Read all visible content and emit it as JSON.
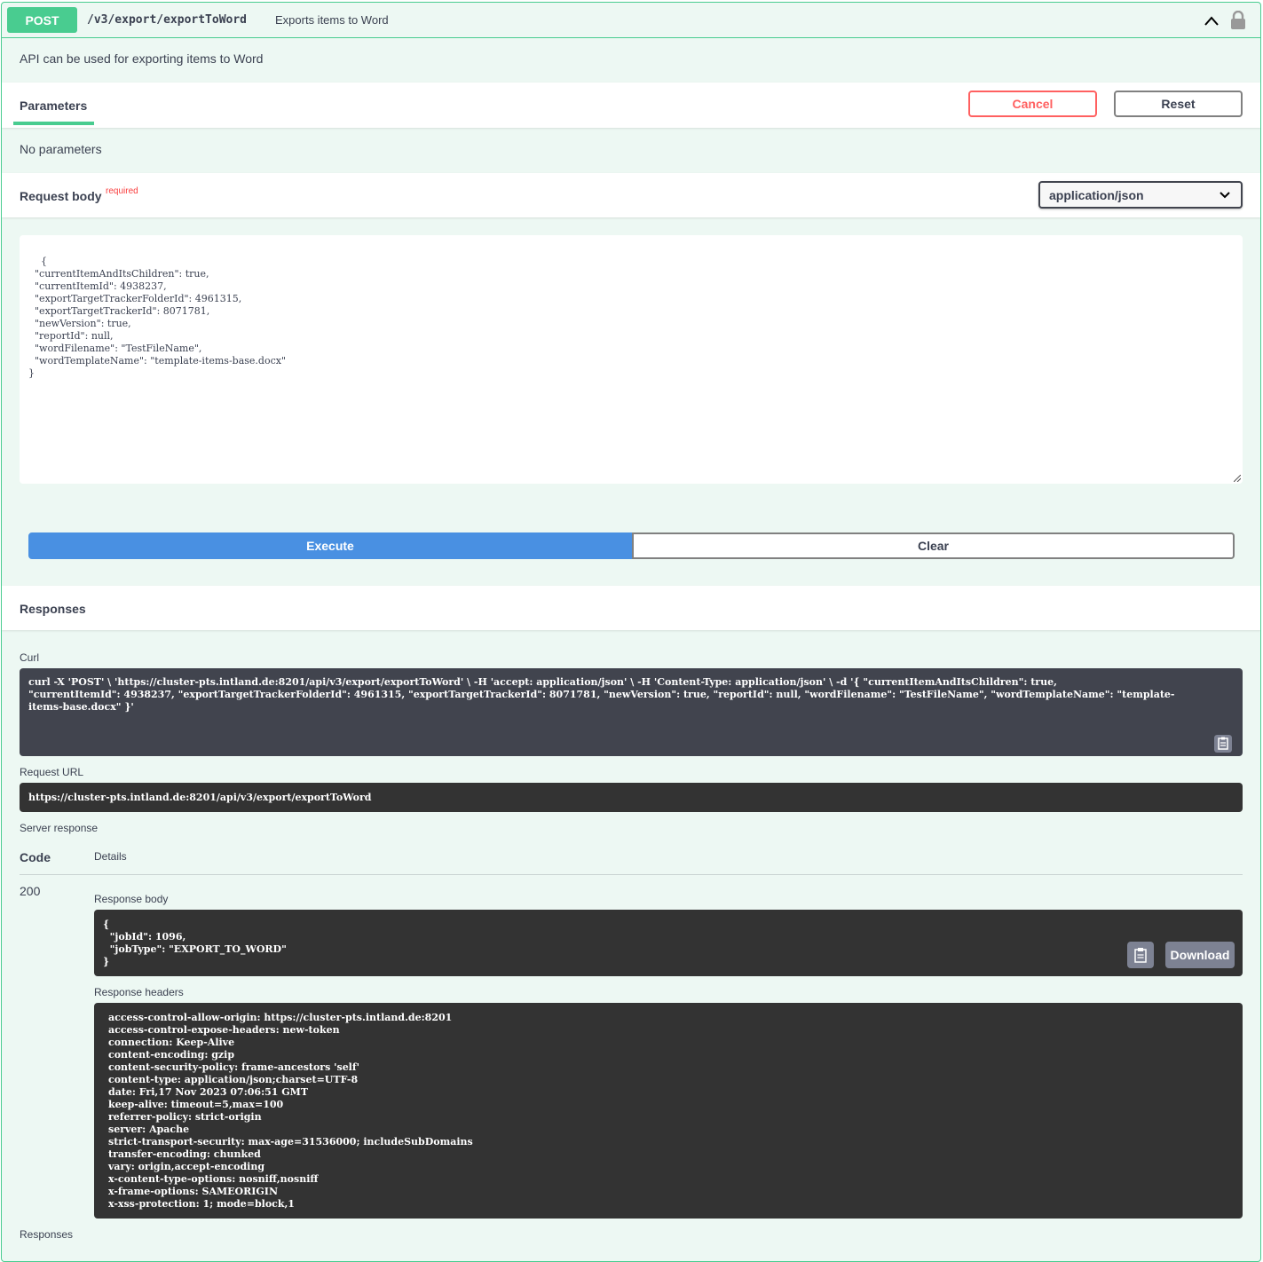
{
  "summary": {
    "method": "POST",
    "path": "/v3/export/exportToWord",
    "title": "Exports items to Word",
    "icons": [
      "chevron-up-icon",
      "lock-icon"
    ]
  },
  "description": "API can be used for exporting items to Word",
  "parameters": {
    "tab_label": "Parameters",
    "cancel_label": "Cancel",
    "reset_label": "Reset",
    "empty_text": "No parameters"
  },
  "request_body": {
    "label": "Request body",
    "required_flag": "required",
    "content_type": "application/json",
    "value": "{\n  \"currentItemAndItsChildren\": true,\n  \"currentItemId\": 4938237,\n  \"exportTargetTrackerFolderId\": 4961315,\n  \"exportTargetTrackerId\": 8071781,\n  \"newVersion\": true,\n  \"reportId\": null,\n  \"wordFilename\": \"TestFileName\",\n  \"wordTemplateName\": \"template-items-base.docx\"\n}"
  },
  "actions": {
    "execute_label": "Execute",
    "clear_label": "Clear"
  },
  "responses": {
    "heading": "Responses",
    "curl_label": "Curl",
    "curl_value": "curl -X 'POST' \\ 'https://cluster-pts.intland.de:8201/api/v3/export/exportToWord' \\ -H 'accept: application/json' \\ -H 'Content-Type: application/json' \\ -d '{ \"currentItemAndItsChildren\": true,\n\"currentItemId\": 4938237, \"exportTargetTrackerFolderId\": 4961315, \"exportTargetTrackerId\": 8071781, \"newVersion\": true, \"reportId\": null, \"wordFilename\": \"TestFileName\", \"wordTemplateName\": \"template-\nitems-base.docx\" }'",
    "request_url_label": "Request URL",
    "request_url": "https://cluster-pts.intland.de:8201/api/v3/export/exportToWord",
    "server_response_label": "Server response",
    "col_code": "Code",
    "col_details": "Details",
    "status_code": "200",
    "response_body_label": "Response body",
    "response_body": "{\n  \"jobId\": 1096,\n  \"jobType\": \"EXPORT_TO_WORD\"\n}",
    "download_label": "Download",
    "response_headers_label": "Response headers",
    "response_headers": "access-control-allow-origin: https://cluster-pts.intland.de:8201\naccess-control-expose-headers: new-token\nconnection: Keep-Alive\ncontent-encoding: gzip\ncontent-security-policy: frame-ancestors 'self'\ncontent-type: application/json;charset=UTF-8\ndate: Fri,17 Nov 2023 07:06:51 GMT\nkeep-alive: timeout=5,max=100\nreferrer-policy: strict-origin\nserver: Apache\nstrict-transport-security: max-age=31536000; includeSubDomains\ntransfer-encoding: chunked\nvary: origin,accept-encoding\nx-content-type-options: nosniff,nosniff\nx-frame-options: SAMEORIGIN\nx-xss-protection: 1; mode=block,1",
    "footer_label": "Responses"
  },
  "colors": {
    "accent": "#49cc90",
    "execute": "#4990e2",
    "cancel": "#ff6060",
    "code_bg": "#333333",
    "curl_bg": "#41444e"
  }
}
